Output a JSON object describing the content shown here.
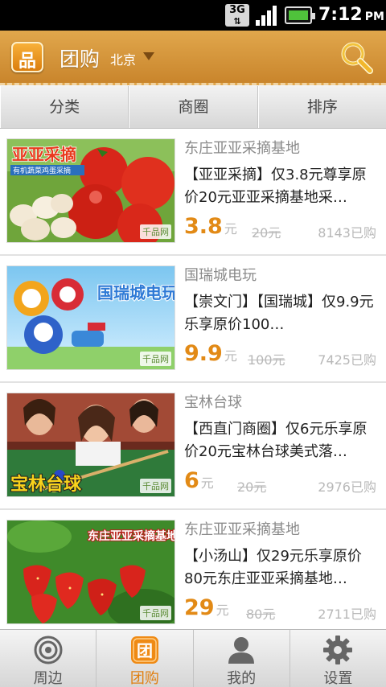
{
  "status_bar": {
    "network": "3G",
    "time": "7:12",
    "ampm": "PM"
  },
  "header": {
    "logo_icon": "品",
    "title": "团购",
    "city": "北京"
  },
  "tabs": [
    {
      "label": "分类"
    },
    {
      "label": "商圈"
    },
    {
      "label": "排序"
    }
  ],
  "deals": [
    {
      "merchant": "东庄亚亚采摘基地",
      "description": "【亚亚采摘】仅3.8元尊享原价20元亚亚采摘基地采…",
      "price": "3.8",
      "currency": "元",
      "original_price": "20元",
      "sold": "8143已购",
      "image_caption": "亚亚采摘",
      "image_subcaption": "有机蔬菜鸡蛋采摘",
      "watermark": "千品网"
    },
    {
      "merchant": "国瑞城电玩",
      "description": "【崇文门】【国瑞城】仅9.9元乐享原价100…",
      "price": "9.9",
      "currency": "元",
      "original_price": "100元",
      "sold": "7425已购",
      "image_caption": "国瑞城电玩",
      "watermark": "千品网"
    },
    {
      "merchant": "宝林台球",
      "description": "【西直门商圈】仅6元乐享原价20元宝林台球美式落…",
      "price": "6",
      "currency": "元",
      "original_price": "20元",
      "sold": "2976已购",
      "image_caption": "宝林台球",
      "watermark": "千品网"
    },
    {
      "merchant": "东庄亚亚采摘基地",
      "description": "【小汤山】仅29元乐享原价80元东庄亚亚采摘基地…",
      "price": "29",
      "currency": "元",
      "original_price": "80元",
      "sold": "2711已购",
      "image_caption": "东庄亚亚采摘基地",
      "watermark": "千品网"
    }
  ],
  "bottom_nav": [
    {
      "label": "周边",
      "icon": "nearby-target-icon"
    },
    {
      "label": "团购",
      "icon": "group-buy-icon",
      "icon_text": "团",
      "active": true
    },
    {
      "label": "我的",
      "icon": "user-icon"
    },
    {
      "label": "设置",
      "icon": "gear-icon"
    }
  ],
  "colors": {
    "accent": "#e28a16",
    "header": "#d79a42"
  }
}
